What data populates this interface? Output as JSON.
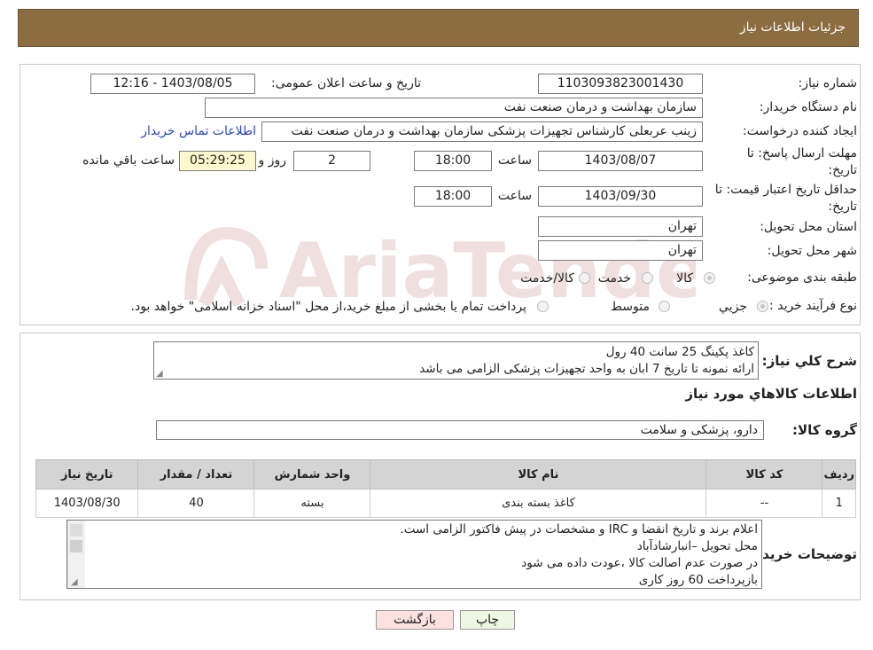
{
  "header": {
    "title": "جزئیات اطلاعات نیاز"
  },
  "form": {
    "need_number_label": "شماره نیاز:",
    "need_number": "1103093823001430",
    "announce_label": "تاریخ و ساعت اعلان عمومی:",
    "announce_value": "1403/08/05 - 12:16",
    "buyer_org_label": "نام دستگاه خریدار:",
    "buyer_org": "سازمان بهداشت و درمان صنعت نفت",
    "requester_label": "ایجاد کننده درخواست:",
    "requester": "زینب عربعلی کارشناس تجهیزات پزشکی سازمان بهداشت و درمان صنعت نفت",
    "contact_link": "اطلاعات تماس خریدار",
    "deadline_label_1": "مهلت ارسال پاسخ: تا",
    "deadline_label_2": "تاریخ:",
    "deadline_date": "1403/08/07",
    "time_label": "ساعت",
    "deadline_time": "18:00",
    "days_value": "2",
    "days_label": "روز و",
    "remaining_time": "05:29:25",
    "remaining_label": "ساعت باقي مانده",
    "price_validity_label_1": "حداقل تاریخ اعتبار قیمت: تا",
    "price_validity_label_2": "تاریخ:",
    "price_validity_date": "1403/09/30",
    "price_validity_time": "18:00",
    "province_label": "استان محل تحویل:",
    "province": "تهران",
    "city_label": "شهر محل تحویل:",
    "city": "تهران",
    "category_label": "طبقه بندی موضوعی:",
    "category_options": [
      "کالا",
      "خدمت",
      "کالا/خدمت"
    ],
    "purchase_type_label": "نوع فرآیند خرید :",
    "purchase_options": [
      "جزیي",
      "متوسط"
    ],
    "purchase_note": "پرداخت تمام یا بخشی از مبلغ خرید،از محل \"اسناد خزانه اسلامی\" خواهد بود."
  },
  "summary": {
    "label": "شرح كلي نياز:",
    "lines": [
      "کاغذ پکینگ 25 سانت 40 رول",
      "ارائه نمونه تا تاریخ 7 ابان به واحد تجهیزات پزشکی الزامی می باشد"
    ]
  },
  "goods": {
    "section_title": "اطلاعات کالاهاي مورد نياز",
    "group_label": "گروه کالا:",
    "group_value": "دارو، پزشکی و سلامت",
    "columns": [
      "ردیف",
      "کد کالا",
      "نام کالا",
      "واحد شمارش",
      "تعداد / مقدار",
      "تاریخ نیاز"
    ],
    "rows": [
      [
        "1",
        "--",
        "کاغذ بسته بندی",
        "بسته",
        "40",
        "1403/08/30"
      ]
    ]
  },
  "buyer_notes": {
    "label": "توضیحات خریدار:",
    "lines": [
      "اعلام برند و تاریخ انقضا  و IRC  و مشخصات  در پیش فاکتور الزامی است.",
      "محل تحویل –انبارشادآباد",
      "در صورت عدم اصالت کالا ،عودت داده می شود",
      "بازپرداخت 60 روز کاری"
    ]
  },
  "buttons": {
    "print": "چاپ",
    "back": "بازگشت"
  },
  "watermark": "AriaTender.neT",
  "colors": {
    "header_bg": "#8b6d41",
    "table_header_bg": "#d4d4d4",
    "remaining_bg": "#fff8cf",
    "link": "#2a44c8"
  }
}
